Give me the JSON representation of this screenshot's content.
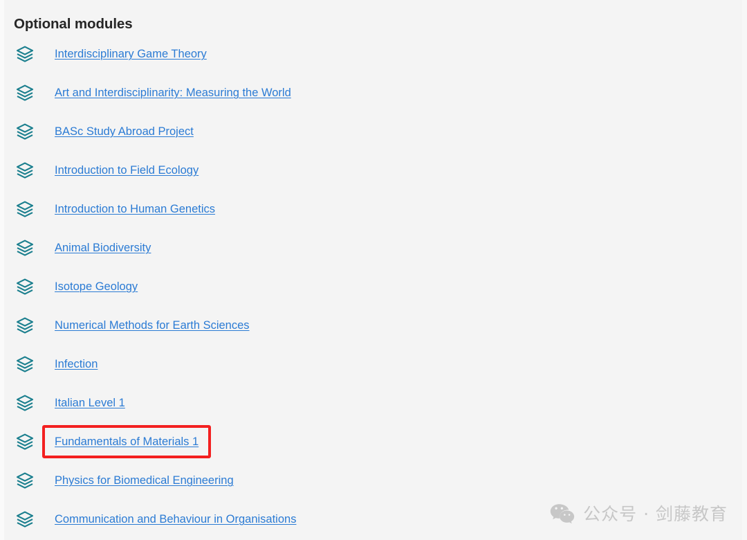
{
  "page": {
    "background_color": "#f4f4f4",
    "heading": "Optional modules"
  },
  "modules": {
    "bullet_icon": "layers-icon",
    "link_color": "#2b7bd4",
    "icon_color": "#1b7f8e",
    "items": [
      {
        "label": "Interdisciplinary Game Theory",
        "highlighted": false
      },
      {
        "label": "Art and Interdisciplinarity: Measuring the World",
        "highlighted": false
      },
      {
        "label": "BASc Study Abroad Project",
        "highlighted": false
      },
      {
        "label": "Introduction to Field Ecology",
        "highlighted": false
      },
      {
        "label": "Introduction to Human Genetics",
        "highlighted": false
      },
      {
        "label": "Animal Biodiversity",
        "highlighted": false
      },
      {
        "label": "Isotope Geology",
        "highlighted": false
      },
      {
        "label": "Numerical Methods for Earth Sciences",
        "highlighted": false
      },
      {
        "label": "Infection",
        "highlighted": false
      },
      {
        "label": "Italian Level 1",
        "highlighted": false
      },
      {
        "label": "Fundamentals of Materials 1",
        "highlighted": true
      },
      {
        "label": "Physics for Biomedical Engineering",
        "highlighted": false
      },
      {
        "label": "Communication and Behaviour in Organisations",
        "highlighted": false
      }
    ]
  },
  "annotation": {
    "type": "highlight-rectangle",
    "color": "#f32020",
    "target_label": "Fundamentals of Materials 1"
  },
  "watermark": {
    "icon": "wechat-icon",
    "text": "公众号 · 剑藤教育",
    "color": "#c7c7c7"
  }
}
